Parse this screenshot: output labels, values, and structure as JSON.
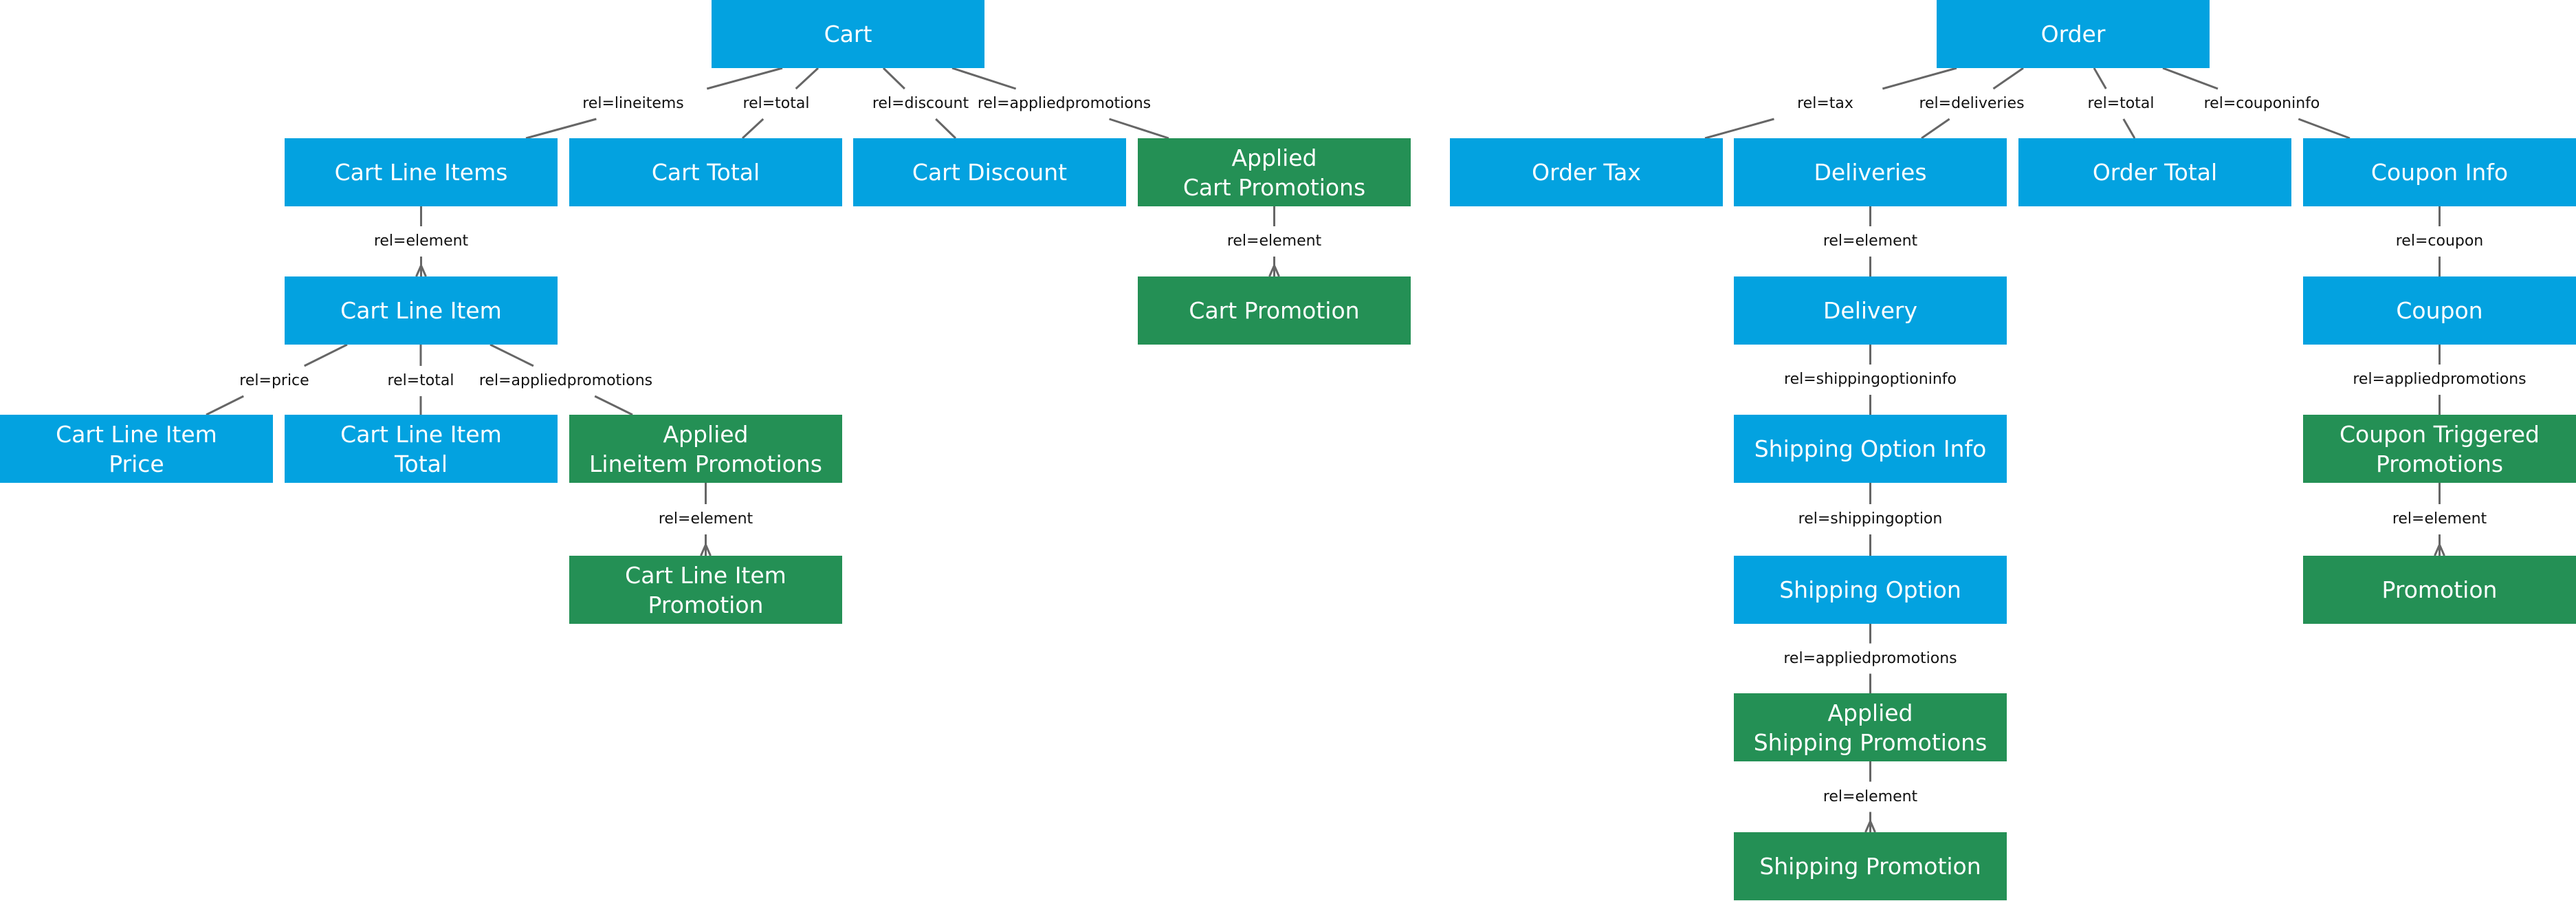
{
  "diagram": {
    "colors": {
      "resource": "#03A2E0",
      "promotion": "#249055",
      "connector": "#666666",
      "label": "#111111"
    },
    "nodes": [
      {
        "id": "cart",
        "label": "Cart",
        "kind": "resource"
      },
      {
        "id": "cart-line-items",
        "label": "Cart Line Items",
        "kind": "resource"
      },
      {
        "id": "cart-total",
        "label": "Cart Total",
        "kind": "resource"
      },
      {
        "id": "cart-discount",
        "label": "Cart Discount",
        "kind": "resource"
      },
      {
        "id": "applied-cart-promotions",
        "label": "Applied\nCart Promotions",
        "kind": "promotion"
      },
      {
        "id": "cart-promotion",
        "label": "Cart Promotion",
        "kind": "promotion"
      },
      {
        "id": "cart-line-item",
        "label": "Cart Line Item",
        "kind": "resource"
      },
      {
        "id": "cart-line-item-price",
        "label": "Cart Line Item\nPrice",
        "kind": "resource"
      },
      {
        "id": "cart-line-item-total",
        "label": "Cart Line Item\nTotal",
        "kind": "resource"
      },
      {
        "id": "applied-lineitem-promotions",
        "label": "Applied\nLineitem Promotions",
        "kind": "promotion"
      },
      {
        "id": "cart-line-item-promotion",
        "label": "Cart Line Item\nPromotion",
        "kind": "promotion"
      },
      {
        "id": "order",
        "label": "Order",
        "kind": "resource"
      },
      {
        "id": "order-tax",
        "label": "Order Tax",
        "kind": "resource"
      },
      {
        "id": "deliveries",
        "label": "Deliveries",
        "kind": "resource"
      },
      {
        "id": "order-total",
        "label": "Order Total",
        "kind": "resource"
      },
      {
        "id": "coupon-info",
        "label": "Coupon Info",
        "kind": "resource"
      },
      {
        "id": "delivery",
        "label": "Delivery",
        "kind": "resource"
      },
      {
        "id": "shipping-option-info",
        "label": "Shipping Option Info",
        "kind": "resource"
      },
      {
        "id": "shipping-option",
        "label": "Shipping Option",
        "kind": "resource"
      },
      {
        "id": "applied-shipping-promotions",
        "label": "Applied\nShipping Promotions",
        "kind": "promotion"
      },
      {
        "id": "shipping-promotion",
        "label": "Shipping Promotion",
        "kind": "promotion"
      },
      {
        "id": "coupon",
        "label": "Coupon",
        "kind": "resource"
      },
      {
        "id": "coupon-triggered-promotions",
        "label": "Coupon Triggered\nPromotions",
        "kind": "promotion"
      },
      {
        "id": "promotion",
        "label": "Promotion",
        "kind": "promotion"
      }
    ],
    "edges": [
      {
        "from": "cart",
        "to": "cart-line-items",
        "label": "rel=lineitems",
        "many": false
      },
      {
        "from": "cart",
        "to": "cart-total",
        "label": "rel=total",
        "many": false
      },
      {
        "from": "cart",
        "to": "cart-discount",
        "label": "rel=discount",
        "many": false
      },
      {
        "from": "cart",
        "to": "applied-cart-promotions",
        "label": "rel=appliedpromotions",
        "many": false
      },
      {
        "from": "applied-cart-promotions",
        "to": "cart-promotion",
        "label": "rel=element",
        "many": true
      },
      {
        "from": "cart-line-items",
        "to": "cart-line-item",
        "label": "rel=element",
        "many": true
      },
      {
        "from": "cart-line-item",
        "to": "cart-line-item-price",
        "label": "rel=price",
        "many": false
      },
      {
        "from": "cart-line-item",
        "to": "cart-line-item-total",
        "label": "rel=total",
        "many": false
      },
      {
        "from": "cart-line-item",
        "to": "applied-lineitem-promotions",
        "label": "rel=appliedpromotions",
        "many": false
      },
      {
        "from": "applied-lineitem-promotions",
        "to": "cart-line-item-promotion",
        "label": "rel=element",
        "many": true
      },
      {
        "from": "order",
        "to": "order-tax",
        "label": "rel=tax",
        "many": false
      },
      {
        "from": "order",
        "to": "deliveries",
        "label": "rel=deliveries",
        "many": false
      },
      {
        "from": "order",
        "to": "order-total",
        "label": "rel=total",
        "many": false
      },
      {
        "from": "order",
        "to": "coupon-info",
        "label": "rel=couponinfo",
        "many": false
      },
      {
        "from": "deliveries",
        "to": "delivery",
        "label": "rel=element",
        "many": false
      },
      {
        "from": "delivery",
        "to": "shipping-option-info",
        "label": "rel=shippingoptioninfo",
        "many": false
      },
      {
        "from": "shipping-option-info",
        "to": "shipping-option",
        "label": "rel=shippingoption",
        "many": false
      },
      {
        "from": "shipping-option",
        "to": "applied-shipping-promotions",
        "label": "rel=appliedpromotions",
        "many": false
      },
      {
        "from": "applied-shipping-promotions",
        "to": "shipping-promotion",
        "label": "rel=element",
        "many": true
      },
      {
        "from": "coupon-info",
        "to": "coupon",
        "label": "rel=coupon",
        "many": false
      },
      {
        "from": "coupon",
        "to": "coupon-triggered-promotions",
        "label": "rel=appliedpromotions",
        "many": false
      },
      {
        "from": "coupon-triggered-promotions",
        "to": "promotion",
        "label": "rel=element",
        "many": true
      }
    ]
  }
}
